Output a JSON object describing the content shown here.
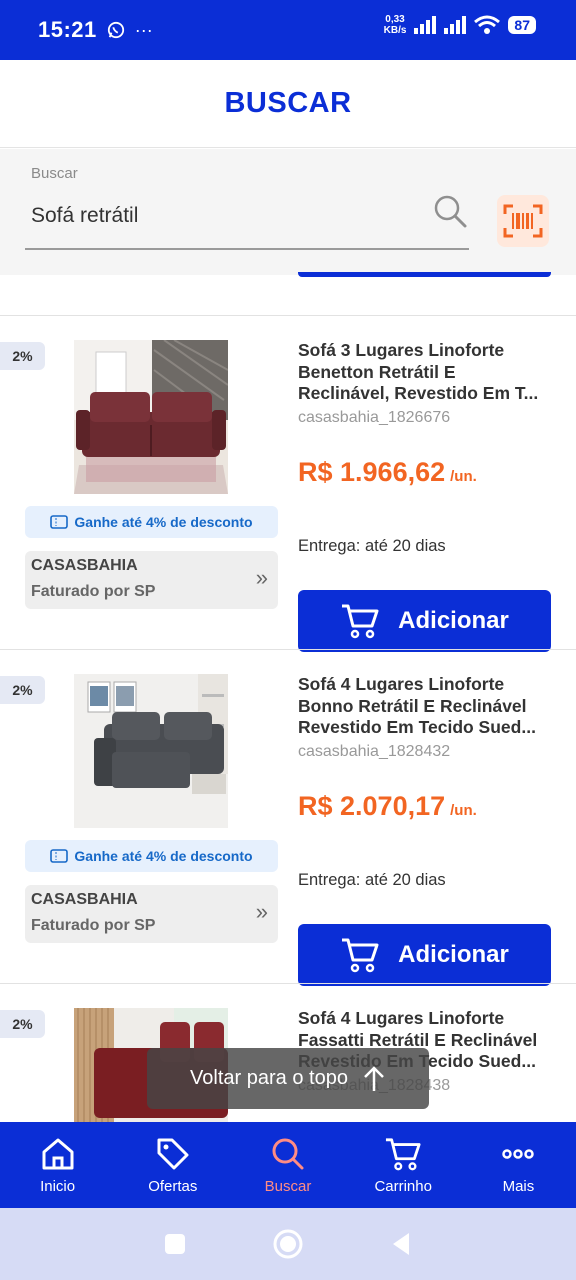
{
  "status_bar": {
    "time": "15:21",
    "extra": "···",
    "net_speed_value": "0,33",
    "net_speed_unit": "KB/s",
    "battery": "87"
  },
  "header": {
    "title": "BUSCAR"
  },
  "search": {
    "label": "Buscar",
    "value": "Sofá retrátil"
  },
  "products": [
    {
      "discount": "2%",
      "title_line1": "Sofá 3 Lugares Linoforte",
      "title_line2": "Benetton Retrátil E",
      "title_line3": "Reclinável, Revestido Em T...",
      "sku": "casasbahia_1826676",
      "price": "R$ 1.966,62",
      "unit": "/un.",
      "delivery": "Entrega: até 20 dias",
      "cashback": "Ganhe até 4% de desconto",
      "seller": "CASASBAHIA",
      "seller_sub": "Faturado por SP",
      "add_label": "Adicionar"
    },
    {
      "discount": "2%",
      "title_line1": "Sofá 4 Lugares Linoforte",
      "title_line2": "Bonno Retrátil E Reclinável",
      "title_line3": "Revestido Em Tecido Sued...",
      "sku": "casasbahia_1828432",
      "price": "R$ 2.070,17",
      "unit": "/un.",
      "delivery": "Entrega: até 20 dias",
      "cashback": "Ganhe até 4% de desconto",
      "seller": "CASASBAHIA",
      "seller_sub": "Faturado por SP",
      "add_label": "Adicionar"
    },
    {
      "discount": "2%",
      "title_line1": "Sofá 4 Lugares Linoforte",
      "title_line2": "Fassatti Retrátil E Reclinável",
      "title_line3": "Revestido Em Tecido Sued...",
      "sku": "casasbahia_1828438"
    }
  ],
  "back_to_top": "Voltar para o topo",
  "bottom_nav": [
    {
      "label": "Inicio",
      "icon": "home-icon"
    },
    {
      "label": "Ofertas",
      "icon": "tag-icon"
    },
    {
      "label": "Buscar",
      "icon": "search-icon",
      "active": true
    },
    {
      "label": "Carrinho",
      "icon": "cart-icon"
    },
    {
      "label": "Mais",
      "icon": "more-icon"
    }
  ],
  "colors": {
    "primary": "#0b2ed6",
    "price": "#f26522",
    "active_nav": "#ff8c84",
    "cashback": "#1769c8"
  }
}
